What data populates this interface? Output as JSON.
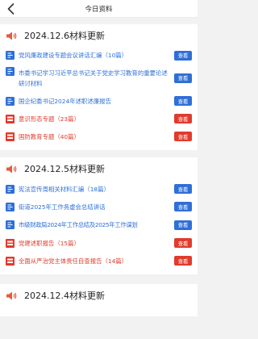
{
  "header": {
    "title": "今日资料"
  },
  "view_label": "查看",
  "colors": {
    "blue": "#2f6fd6",
    "red": "#e03b2c",
    "speaker": "#e65a3d"
  },
  "sections": [
    {
      "date": "2024.12.6材料更新",
      "items": [
        {
          "text": "党风廉政建设专题会议讲话汇编（10篇）",
          "type": "doc",
          "color": "blue"
        },
        {
          "text": "市委书记学习习近平总书记关于党史学习教育的重要论述研讨材料",
          "type": "doc",
          "color": "blue"
        },
        {
          "text": "国企纪委书记2024年述职述廉报告",
          "type": "doc",
          "color": "blue"
        },
        {
          "text": "意识形态专题（23篇）",
          "type": "folder",
          "color": "red"
        },
        {
          "text": "国防教育专题（40篇）",
          "type": "folder",
          "color": "red"
        }
      ]
    },
    {
      "date": "2024.12.5材料更新",
      "items": [
        {
          "text": "宪法宣传周相关材料汇编（18篇）",
          "type": "doc",
          "color": "blue"
        },
        {
          "text": "街道2025年工作务虚会总结讲话",
          "type": "doc",
          "color": "blue"
        },
        {
          "text": "市级财政局2024年工作总结及2025年工作谋划",
          "type": "doc",
          "color": "blue"
        },
        {
          "text": "党建述职报告（15篇）",
          "type": "folder",
          "color": "red"
        },
        {
          "text": "全面从严治党主体责任自查报告（14篇）",
          "type": "folder",
          "color": "red"
        }
      ]
    },
    {
      "date": "2024.12.4材料更新",
      "items": []
    }
  ]
}
